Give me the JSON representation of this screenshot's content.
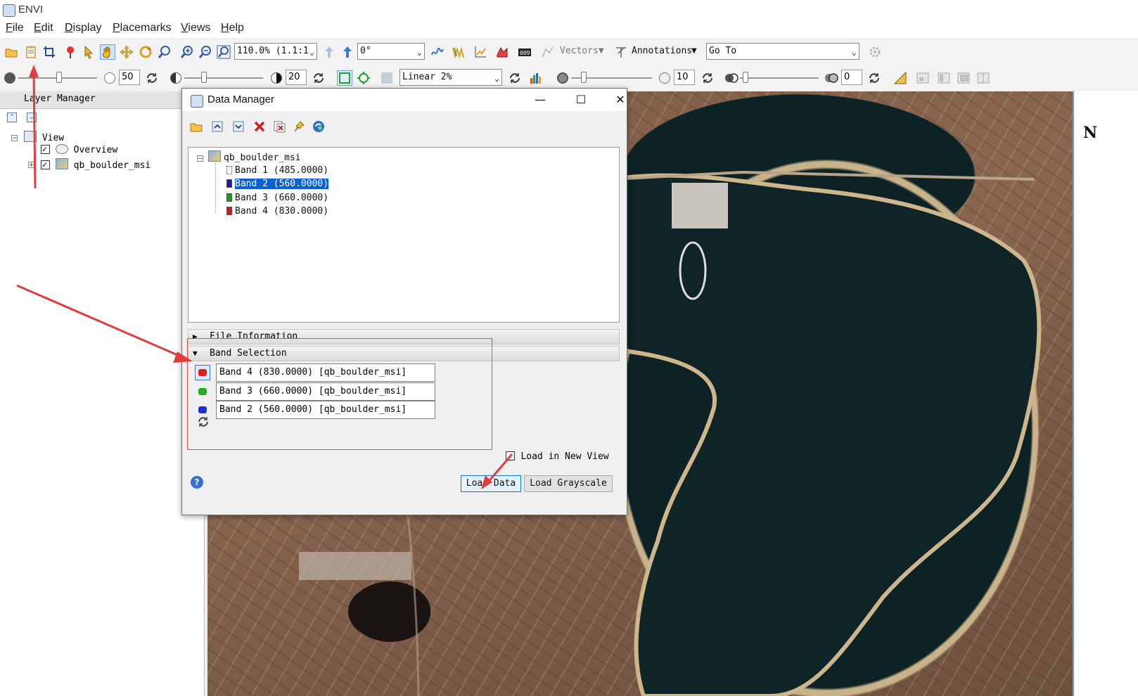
{
  "window": {
    "title": "ENVI"
  },
  "menu": [
    "File",
    "Edit",
    "Display",
    "Placemarks",
    "Views",
    "Help"
  ],
  "toolbar1": {
    "zoom_value": "110.0% (1.1:1",
    "rotation_value": "0°",
    "vectors_label": "Vectors",
    "annotations_label": "Annotations",
    "goto_value": "Go To"
  },
  "toolbar2": {
    "brightness_value": "50",
    "contrast_value": "20",
    "stretch_value": "Linear 2%",
    "sharpen_value": "10",
    "transparency_value": "0"
  },
  "layer_manager": {
    "title": "Layer Manager",
    "root": "View",
    "items": [
      {
        "label": "Overview",
        "checked": true
      },
      {
        "label": "qb_boulder_msi",
        "checked": true
      }
    ]
  },
  "data_manager": {
    "title": "Data Manager",
    "file_name": "qb_boulder_msi",
    "bands": [
      {
        "label": "Band 1 (485.0000)",
        "color": "#ffffff",
        "selected": false
      },
      {
        "label": "Band 2 (560.0000)",
        "color": "#1a1aa0",
        "selected": true
      },
      {
        "label": "Band 3 (660.0000)",
        "color": "#16a016",
        "selected": false
      },
      {
        "label": "Band 4 (830.0000)",
        "color": "#d01818",
        "selected": false
      }
    ],
    "sections": {
      "file_information": "File Information",
      "band_selection": "Band Selection"
    },
    "band_selection": [
      {
        "label": "Band 4 (830.0000) [qb_boulder_msi]",
        "channel_color": "#e02020"
      },
      {
        "label": "Band 3 (660.0000) [qb_boulder_msi]",
        "channel_color": "#20b020"
      },
      {
        "label": "Band 2 (560.0000) [qb_boulder_msi]",
        "channel_color": "#2030d0"
      }
    ],
    "load_in_new_view": "Load in New View",
    "load_data": "Load Data",
    "load_grayscale": "Load Grayscale",
    "help_glyph": "?"
  },
  "map": {
    "north_label": "N"
  }
}
